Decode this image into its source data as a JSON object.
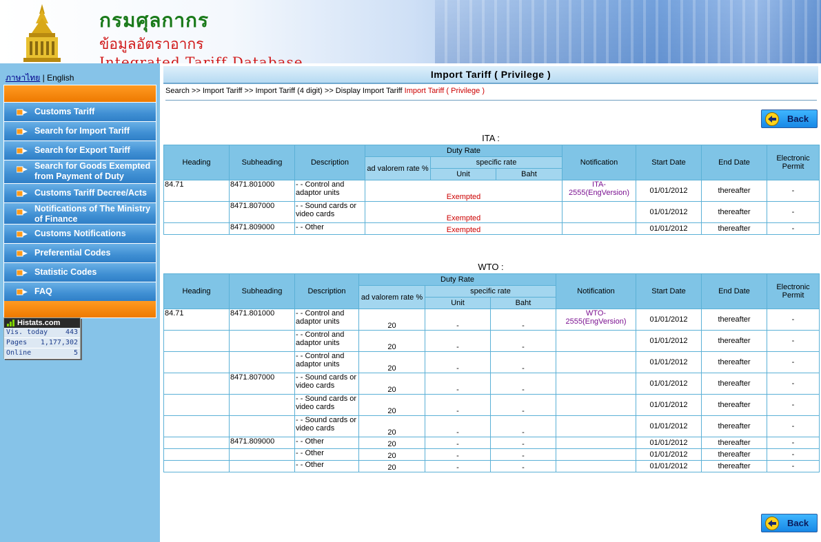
{
  "header": {
    "dept_name": "กรมศุลกากร",
    "db_name_th": "ข้อมูลอัตราอากร",
    "db_name_en": "Integrated Tariff Database"
  },
  "sidebar": {
    "lang_thai": "ภาษาไทย",
    "lang_sep": "|",
    "lang_english": "English",
    "menu": [
      {
        "label": "Customs Tariff"
      },
      {
        "label": "Search for Import Tariff"
      },
      {
        "label": "Search for Export Tariff"
      },
      {
        "label": "Search for Goods Exempted from Payment of Duty"
      },
      {
        "label": "Customs Tariff Decree/Acts"
      },
      {
        "label": "Notifications of The Ministry of Finance"
      },
      {
        "label": "Customs Notifications"
      },
      {
        "label": "Preferential Codes"
      },
      {
        "label": "Statistic Codes"
      },
      {
        "label": "FAQ"
      }
    ],
    "histats": {
      "brand": "Histats.com",
      "rows": [
        {
          "label": "Vis. today",
          "value": "443"
        },
        {
          "label": "Pages",
          "value": "1,177,302"
        },
        {
          "label": "Online",
          "value": "5"
        }
      ]
    }
  },
  "main": {
    "title": "Import Tariff ( Privilege )",
    "breadcrumb": "Search >> Import Tariff >> Import Tariff (4 digit) >> Display Import Tariff ",
    "breadcrumb_current": "Import Tariff ( Privilege )",
    "back_label": "Back",
    "columns": {
      "heading": "Heading",
      "subheading": "Subheading",
      "description": "Description",
      "duty_rate": "Duty Rate",
      "ad_valorem": "ad valorem rate %",
      "specific_rate": "specific rate",
      "unit": "Unit",
      "baht": "Baht",
      "notification": "Notification",
      "start_date": "Start Date",
      "end_date": "End Date",
      "electronic_permit": "Electronic Permit"
    },
    "ita": {
      "title": "ITA :",
      "rows": [
        {
          "heading": "84.71",
          "subheading": "8471.801000",
          "description": "- - Control and adaptor units",
          "rate": "Exempted",
          "notification": "ITA-2555(EngVersion)",
          "start": "01/01/2012",
          "end": "thereafter",
          "permit": "-"
        },
        {
          "heading": "",
          "subheading": "8471.807000",
          "description": "- - Sound cards or video cards",
          "rate": "Exempted",
          "notification": "",
          "start": "01/01/2012",
          "end": "thereafter",
          "permit": "-"
        },
        {
          "heading": "",
          "subheading": "8471.809000",
          "description": "- - Other",
          "rate": "Exempted",
          "notification": "",
          "start": "01/01/2012",
          "end": "thereafter",
          "permit": "-"
        }
      ]
    },
    "wto": {
      "title": "WTO :",
      "rows": [
        {
          "heading": "84.71",
          "subheading": "8471.801000",
          "description": "- - Control and adaptor units",
          "adval": "20",
          "unit": "-",
          "baht": "-",
          "notification": "WTO-2555(EngVersion)",
          "start": "01/01/2012",
          "end": "thereafter",
          "permit": "-"
        },
        {
          "heading": "",
          "subheading": "",
          "description": "- - Control and adaptor units",
          "adval": "20",
          "unit": "-",
          "baht": "-",
          "notification": "",
          "start": "01/01/2012",
          "end": "thereafter",
          "permit": "-"
        },
        {
          "heading": "",
          "subheading": "",
          "description": "- - Control and adaptor units",
          "adval": "20",
          "unit": "-",
          "baht": "-",
          "notification": "",
          "start": "01/01/2012",
          "end": "thereafter",
          "permit": "-"
        },
        {
          "heading": "",
          "subheading": "8471.807000",
          "description": "- - Sound cards or video cards",
          "adval": "20",
          "unit": "-",
          "baht": "-",
          "notification": "",
          "start": "01/01/2012",
          "end": "thereafter",
          "permit": "-"
        },
        {
          "heading": "",
          "subheading": "",
          "description": "- - Sound cards or video cards",
          "adval": "20",
          "unit": "-",
          "baht": "-",
          "notification": "",
          "start": "01/01/2012",
          "end": "thereafter",
          "permit": "-"
        },
        {
          "heading": "",
          "subheading": "",
          "description": "- - Sound cards or video cards",
          "adval": "20",
          "unit": "-",
          "baht": "-",
          "notification": "",
          "start": "01/01/2012",
          "end": "thereafter",
          "permit": "-"
        },
        {
          "heading": "",
          "subheading": "8471.809000",
          "description": "- - Other",
          "adval": "20",
          "unit": "-",
          "baht": "-",
          "notification": "",
          "start": "01/01/2012",
          "end": "thereafter",
          "permit": "-"
        },
        {
          "heading": "",
          "subheading": "",
          "description": "- - Other",
          "adval": "20",
          "unit": "-",
          "baht": "-",
          "notification": "",
          "start": "01/01/2012",
          "end": "thereafter",
          "permit": "-"
        },
        {
          "heading": "",
          "subheading": "",
          "description": "- - Other",
          "adval": "20",
          "unit": "-",
          "baht": "-",
          "notification": "",
          "start": "01/01/2012",
          "end": "thereafter",
          "permit": "-"
        }
      ]
    }
  },
  "colors": {
    "sidebar_bg": "#86c3e8",
    "menu_blue": "#3f8fd3",
    "menu_orange": "#ee7a00",
    "table_header": "#7fc4e6",
    "exempted_red": "#cc0000",
    "notification_purple": "#7a1090"
  },
  "icons": {
    "menu_item": "arrow-right-icon",
    "back": "back-arrow-icon",
    "logo": "customs-emblem-logo"
  }
}
